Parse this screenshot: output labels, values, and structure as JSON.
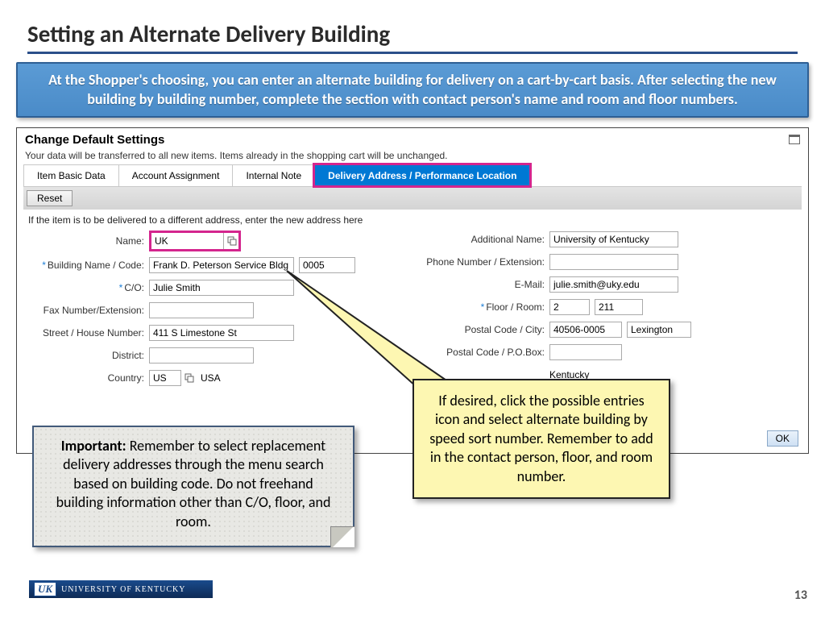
{
  "title": "Setting an Alternate Delivery Building",
  "banner": "At the Shopper's choosing, you can enter an alternate building for delivery on a cart-by-cart basis. After selecting the new building by building number, complete the section with contact person's name and room and floor numbers.",
  "panel": {
    "title": "Change Default Settings",
    "note": "Your data will be transferred to all new items. Items already in the shopping cart will be unchanged.",
    "tabs": [
      "Item Basic Data",
      "Account Assignment",
      "Internal Note",
      "Delivery Address / Performance Location"
    ],
    "active_tab": 3,
    "reset": "Reset",
    "form_note": "If the item is to be delivered to a different address, enter the new address here",
    "ok": "OK"
  },
  "left": {
    "name_label": "Name:",
    "name": "UK",
    "building_label": "Building Name / Code:",
    "building": "Frank D. Peterson Service Bldg",
    "building_code": "0005",
    "co_label": "C/O:",
    "co": "Julie Smith",
    "fax_label": "Fax Number/Extension:",
    "fax": "",
    "street_label": "Street / House Number:",
    "street": "411 S Limestone St",
    "district_label": "District:",
    "district": "",
    "country_label": "Country:",
    "country": "US",
    "country_text": "USA"
  },
  "right": {
    "addl_name_label": "Additional Name:",
    "addl_name": "University of Kentucky",
    "phone_label": "Phone Number / Extension:",
    "phone": "",
    "email_label": "E-Mail:",
    "email": "julie.smith@uky.edu",
    "floor_label": "Floor / Room:",
    "floor": "2",
    "room": "211",
    "postal_city_label": "Postal Code / City:",
    "postal": "40506-0005",
    "city": "Lexington",
    "pobox_label": "Postal Code / P.O.Box:",
    "region": "Kentucky"
  },
  "important": {
    "bold": "Important: ",
    "text": "Remember to select replacement delivery addresses through the menu search based on building code. Do not freehand building information other than C/O, floor, and room."
  },
  "callout": "If desired, click the possible entries icon and select alternate building by speed sort number. Remember to add in the contact person, floor, and room number.",
  "footer": {
    "logo": "UK",
    "name": "UNIVERSITY OF KENTUCKY"
  },
  "page": "13"
}
